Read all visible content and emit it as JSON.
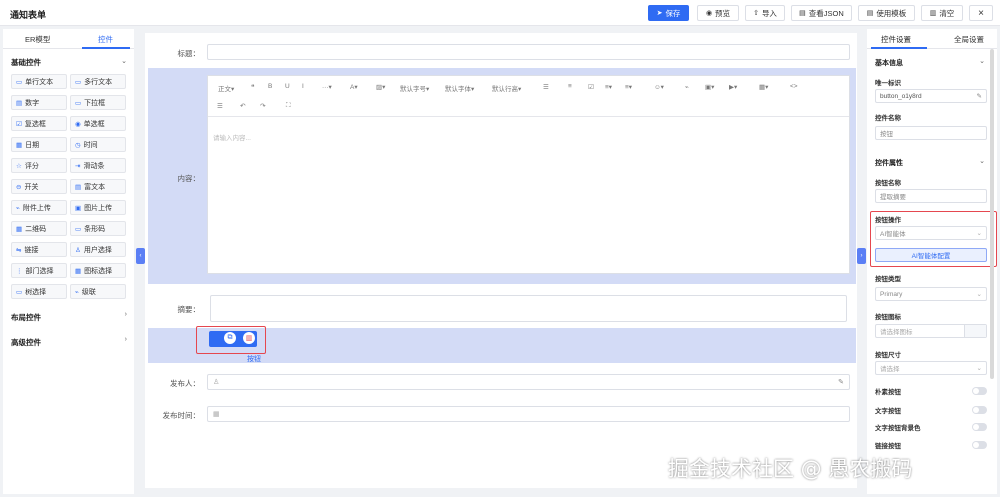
{
  "app": {
    "title": "通知表单"
  },
  "toolbar": {
    "save": "保存",
    "preview": "预览",
    "import": "导入",
    "view_json": "查看JSON",
    "use_template": "使用模板",
    "clear": "清空",
    "close": "×"
  },
  "left_panel": {
    "tabs": [
      "ER模型",
      "控件"
    ],
    "basic_group": "基础控件",
    "layout_group": "布局控件",
    "advanced_group": "高级控件",
    "components": [
      {
        "label": "单行文本",
        "icon": "▭"
      },
      {
        "label": "多行文本",
        "icon": "▭"
      },
      {
        "label": "数字",
        "icon": "▤"
      },
      {
        "label": "下拉框",
        "icon": "▭"
      },
      {
        "label": "复选框",
        "icon": "☑"
      },
      {
        "label": "单选框",
        "icon": "◉"
      },
      {
        "label": "日期",
        "icon": "▦"
      },
      {
        "label": "时间",
        "icon": "◷"
      },
      {
        "label": "评分",
        "icon": "☆"
      },
      {
        "label": "滑动条",
        "icon": "⇥"
      },
      {
        "label": "开关",
        "icon": "⊖"
      },
      {
        "label": "富文本",
        "icon": "▤"
      },
      {
        "label": "附件上传",
        "icon": "⌁"
      },
      {
        "label": "图片上传",
        "icon": "▣"
      },
      {
        "label": "二维码",
        "icon": "▦"
      },
      {
        "label": "条形码",
        "icon": "▭"
      },
      {
        "label": "链接",
        "icon": "⇋"
      },
      {
        "label": "用户选择",
        "icon": "♙"
      },
      {
        "label": "部门选择",
        "icon": "⋮"
      },
      {
        "label": "图标选择",
        "icon": "▦"
      },
      {
        "label": "树选择",
        "icon": "▭"
      },
      {
        "label": "级联",
        "icon": "⌁"
      }
    ]
  },
  "form": {
    "title_label": "标题：",
    "content_label": "内容：",
    "summary_label": "摘要：",
    "publisher_label": "发布人：",
    "publish_time_label": "发布时间：",
    "button_caption": "按钮",
    "editor": {
      "placeholder": "请输入内容...",
      "row1": [
        "正文▾",
        "❝",
        "B",
        "U",
        "I",
        "···▾",
        "A▾",
        "▨▾",
        "默认字号▾",
        "默认字体▾",
        "默认行高▾",
        "☰",
        "≡",
        "☑",
        "≡▾",
        "≡▾",
        "☺▾",
        "⌁",
        "▣▾",
        "▶▾",
        "▦▾",
        "<>"
      ],
      "row2": [
        "☰",
        "↶",
        "↷",
        "⛶"
      ]
    }
  },
  "right_panel": {
    "tabs": [
      "控件设置",
      "全局设置"
    ],
    "basic_info": "基本信息",
    "unique_id_label": "唯一标识",
    "unique_id_value": "button_o1y8rd",
    "control_name_label": "控件名称",
    "control_name_value": "按钮",
    "control_props": "控件属性",
    "button_name_label": "按钮名称",
    "button_name_value": "提取摘要",
    "button_action_label": "按钮操作",
    "button_action_value": "AI智能体",
    "ai_config_button": "AI智能体配置",
    "button_type_label": "按钮类型",
    "button_type_value": "Primary",
    "button_icon_label": "按钮图标",
    "button_icon_placeholder": "请选择图标",
    "button_size_label": "按钮尺寸",
    "button_size_placeholder": "请选择",
    "toggles": [
      "朴素按钮",
      "文字按钮",
      "文字按钮背景色",
      "链接按钮"
    ]
  },
  "watermark": "掘金技术社区 @ 愚农搬码",
  "colors": {
    "primary": "#2f6bf3",
    "highlight": "#e5474f",
    "selection": "#d3dbf6"
  }
}
